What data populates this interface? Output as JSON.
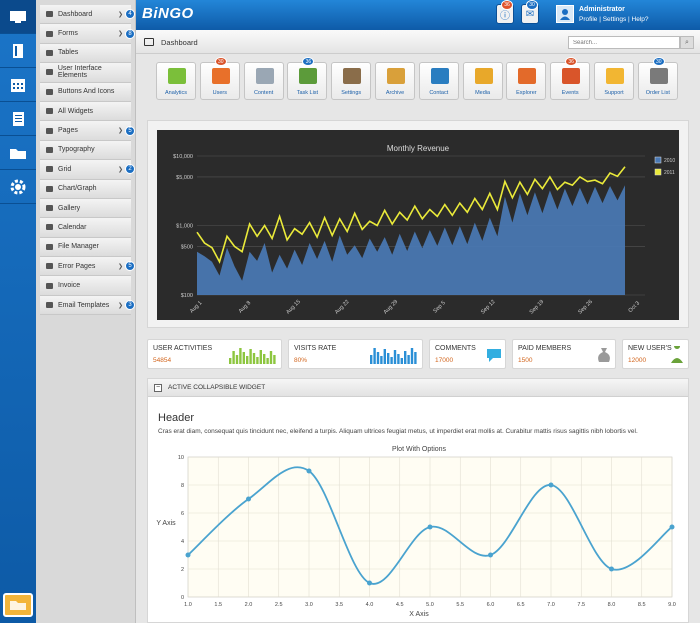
{
  "app": {
    "brand": "BiNGO"
  },
  "nav": [
    {
      "label": "Dashboard",
      "badge": "4"
    },
    {
      "label": "Forms",
      "badge": "8"
    },
    {
      "label": "Tables"
    },
    {
      "label": "User Interface Elements"
    },
    {
      "label": "Buttons And Icons"
    },
    {
      "label": "All Widgets"
    },
    {
      "label": "Pages",
      "badge": "5"
    },
    {
      "label": "Typography"
    },
    {
      "label": "Grid",
      "badge": "2"
    },
    {
      "label": "Chart/Graph"
    },
    {
      "label": "Gallery"
    },
    {
      "label": "Calendar"
    },
    {
      "label": "File Manager"
    },
    {
      "label": "Error Pages",
      "badge": "5"
    },
    {
      "label": "Invoice"
    },
    {
      "label": "Email Templates",
      "badge": "3"
    }
  ],
  "header": {
    "notif_badge": "36",
    "mail_badge": "30",
    "user_name": "Administrator",
    "user_links": "Profile | Settings | Help?"
  },
  "breadcrumb": {
    "label": "Dashboard"
  },
  "search": {
    "placeholder": "Search..."
  },
  "tiles": [
    {
      "label": "Analytics",
      "icon": "pie-chart-icon"
    },
    {
      "label": "Users",
      "icon": "user-icon",
      "badge": "30",
      "badge_color": "#d9532a"
    },
    {
      "label": "Content",
      "icon": "content-icon"
    },
    {
      "label": "Task List",
      "icon": "task-list-icon",
      "badge": "36",
      "badge_color": "#1b6ec2"
    },
    {
      "label": "Settings",
      "icon": "settings-icon"
    },
    {
      "label": "Archive",
      "icon": "archive-icon"
    },
    {
      "label": "Contact",
      "icon": "contact-icon"
    },
    {
      "label": "Media",
      "icon": "media-icon"
    },
    {
      "label": "Explorer",
      "icon": "explorer-icon"
    },
    {
      "label": "Events",
      "icon": "events-icon",
      "badge": "36",
      "badge_color": "#d9532a"
    },
    {
      "label": "Support",
      "icon": "support-icon"
    },
    {
      "label": "Order List",
      "icon": "order-list-icon",
      "badge": "30",
      "badge_color": "#1b6ec2"
    }
  ],
  "stats": [
    {
      "title": "USER ACTIVITIES",
      "value": "54854"
    },
    {
      "title": "VISITS RATE",
      "value": "80%"
    },
    {
      "title": "COMMENTS",
      "value": "17000"
    },
    {
      "title": "PAID MEMBERS",
      "value": "1500"
    },
    {
      "title": "NEW USER'S",
      "value": "12000"
    }
  ],
  "widget": {
    "title": "ACTIVE COLLAPSIBLE WIDGET",
    "heading": "Header",
    "paragraph": "Cras erat diam, consequat quis tincidunt nec, eleifend a turpis. Aliquam ultrices feugiat metus, ut imperdiet erat mollis at. Curabitur mattis risus sagittis nibh lobortis vel."
  },
  "chart_data": [
    {
      "type": "area",
      "title": "Monthly Revenue",
      "scale": "log",
      "ylim": [
        100,
        10000
      ],
      "yticks": [
        "$10,000",
        "$5,000",
        "$1,000",
        "$500",
        "$100"
      ],
      "ytick_values": [
        10000,
        5000,
        1000,
        500,
        100
      ],
      "xticks": [
        "Aug 1",
        "Aug 8",
        "Aug 15",
        "Aug 22",
        "Aug 29",
        "Sep 5",
        "Sep 12",
        "Sep 19",
        "Sep 26",
        "Oct 3"
      ],
      "legend_position": "top-right",
      "series": [
        {
          "name": "2010",
          "color": "#4a79b5",
          "values": [
            420,
            360,
            300,
            190,
            480,
            260,
            160,
            420,
            310,
            560,
            210,
            380,
            240,
            450,
            270,
            560,
            330,
            600,
            300,
            720,
            380,
            520,
            340,
            650,
            420,
            680,
            380,
            760,
            430,
            820,
            470,
            860,
            510,
            940,
            520,
            980,
            540,
            1100,
            600,
            1300,
            700,
            2600,
            1100,
            2900,
            1400,
            3000,
            1500,
            3200,
            1700,
            3400,
            1900,
            3500,
            2000,
            3600,
            2100,
            3700,
            2300,
            3800
          ]
        },
        {
          "name": "2011",
          "color": "#eaea3a",
          "values": [
            800,
            560,
            480,
            300,
            700,
            500,
            420,
            1050,
            700,
            1000,
            650,
            1350,
            620,
            900,
            750,
            1100,
            680,
            1300,
            720,
            1250,
            820,
            1500,
            880,
            1150,
            1000,
            1650,
            1050,
            1550,
            1200,
            1900,
            1250,
            1700,
            1350,
            2000,
            1400,
            2100,
            1550,
            2450,
            1700,
            2900,
            1700,
            4300,
            2500,
            4200,
            2800,
            4600,
            3400,
            5000,
            3300,
            4200,
            3800,
            5000,
            4300,
            4500,
            4000,
            5700,
            5100,
            7000
          ]
        }
      ]
    },
    {
      "type": "line",
      "title": "Plot With Options",
      "xlabel": "X Axis",
      "ylabel": "Y Axis",
      "xlim": [
        1,
        9
      ],
      "ylim": [
        0,
        10
      ],
      "x": [
        1,
        2,
        3,
        4,
        5,
        6,
        7,
        8,
        9
      ],
      "series": [
        {
          "name": "",
          "color": "#4aa3cf",
          "values": [
            3,
            7,
            9,
            1,
            5,
            3,
            8,
            2,
            5
          ]
        }
      ]
    }
  ]
}
